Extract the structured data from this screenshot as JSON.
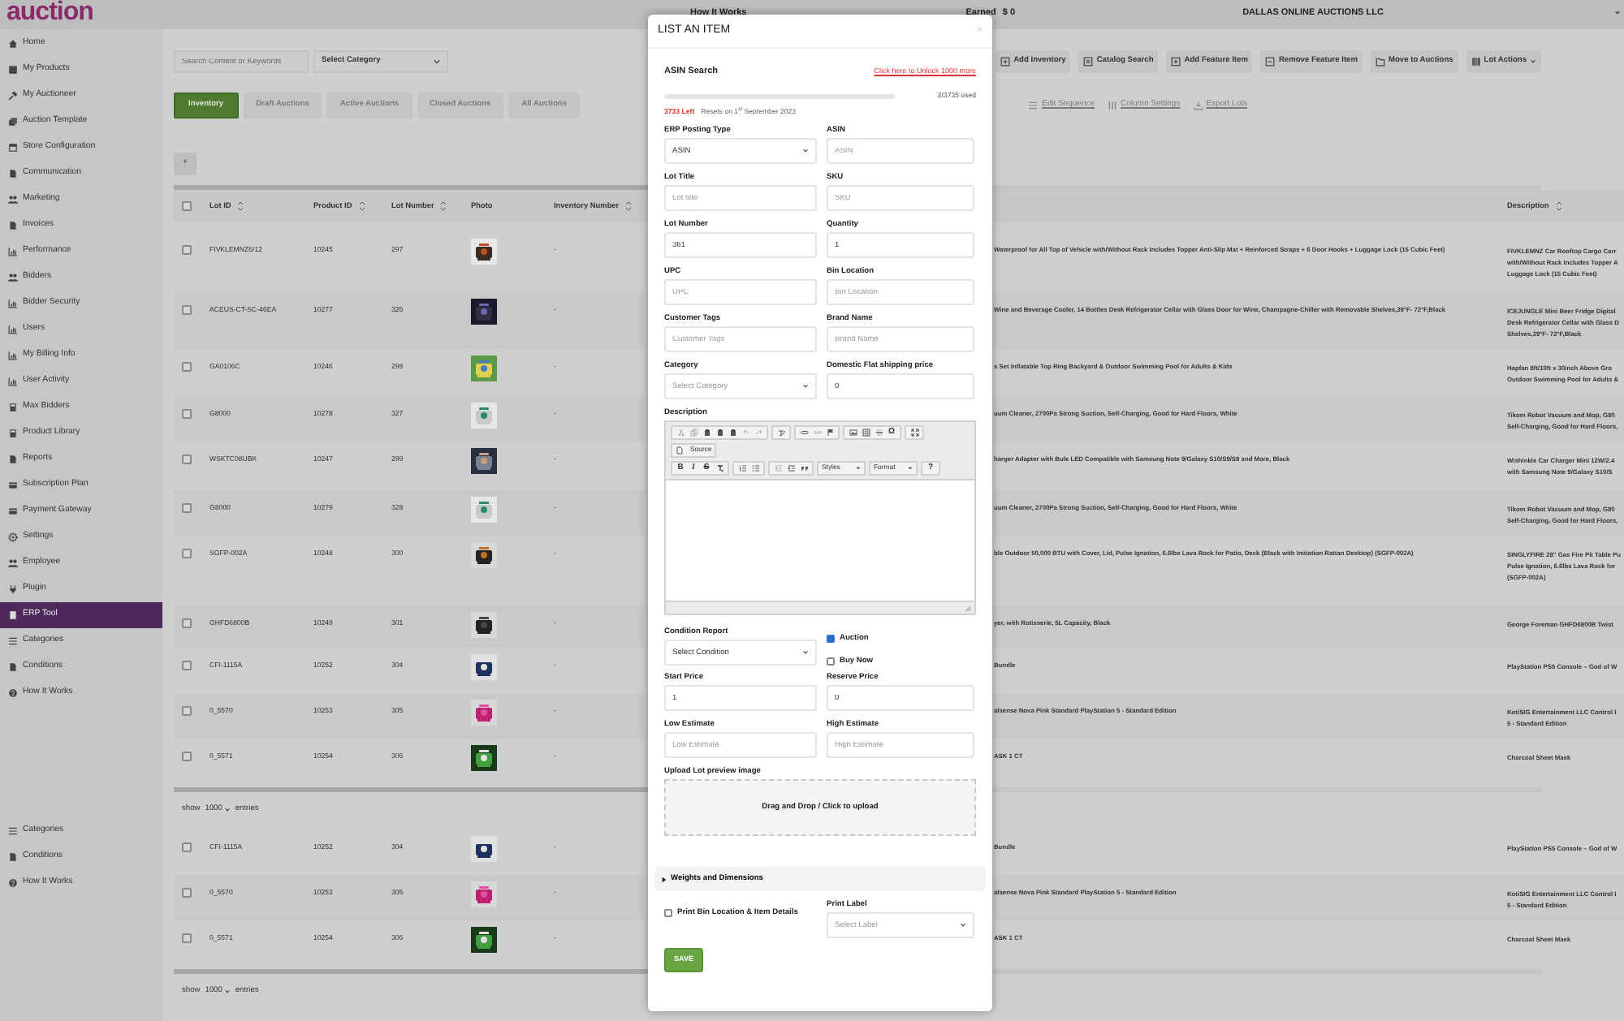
{
  "logo": {
    "text": "auction"
  },
  "header": {
    "links": [
      "How It Works",
      "Earned",
      "$ 0"
    ],
    "company": "DALLAS ONLINE AUCTIONS LLC"
  },
  "sidebar": {
    "items": [
      {
        "label": "Home",
        "selected": false
      },
      {
        "label": "My Products",
        "selected": false
      },
      {
        "label": "My Auctioneer",
        "selected": false
      },
      {
        "label": "Auction Template",
        "selected": false
      },
      {
        "label": "Store Configuration",
        "selected": false
      },
      {
        "label": "Communication",
        "selected": false
      },
      {
        "label": "Marketing",
        "selected": false
      },
      {
        "label": "Invoices",
        "selected": false
      },
      {
        "label": "Performance",
        "selected": false
      },
      {
        "label": "Bidders",
        "selected": false
      },
      {
        "label": "Bidder Security",
        "selected": false
      },
      {
        "label": "Users",
        "selected": false
      },
      {
        "label": "My Billing Info",
        "selected": false
      },
      {
        "label": "User Activity",
        "selected": false
      },
      {
        "label": "Max Bidders",
        "selected": false
      },
      {
        "label": "Product Library",
        "selected": false
      },
      {
        "label": "Reports",
        "selected": false
      },
      {
        "label": "Subscription Plan",
        "selected": false
      },
      {
        "label": "Payment Gateway",
        "selected": false
      },
      {
        "label": "Settings",
        "selected": false
      },
      {
        "label": "Employee",
        "selected": false
      },
      {
        "label": "Plugin",
        "selected": false
      },
      {
        "label": "ERP Tool",
        "selected": true
      },
      {
        "label": "Categories",
        "selected": false
      },
      {
        "label": "Conditions",
        "selected": false
      },
      {
        "label": "How It Works",
        "selected": false
      }
    ],
    "lower_items": [
      {
        "label": "Categories",
        "selected": false
      },
      {
        "label": "Conditions",
        "selected": false
      },
      {
        "label": "How It Works",
        "selected": false
      }
    ]
  },
  "filters": {
    "search": {
      "placeholder": "Search Content or Keywords"
    },
    "category": {
      "value": "Select Category"
    }
  },
  "toolbar": [
    "Add Inventory",
    "Catalog Search",
    "Add Feature Item",
    "Remove Feature Item",
    "Move to Auctions",
    "Lot Actions"
  ],
  "toolbar_links": [
    "Edit Sequence",
    "Column Settings",
    "Export Lots"
  ],
  "tabs": [
    {
      "label": "Inventory",
      "selected": true
    },
    {
      "label": "Draft Auctions",
      "selected": false
    },
    {
      "label": "Active Auctions",
      "selected": false
    },
    {
      "label": "Closed Auctions",
      "selected": false
    },
    {
      "label": "All Auctions",
      "selected": false
    }
  ],
  "add_button": "+",
  "table": {
    "header_checked": false,
    "columns": [
      "Lot ID",
      "Product ID",
      "Lot Number",
      "Photo",
      "Inventory Number",
      "Description"
    ],
    "rows": [
      {
        "checked": false,
        "lot_id": "FIVKLEMNZ6/12",
        "product_id": "10245",
        "lot_number": "297",
        "inventory_number": "-",
        "title": "Waterproof for All Top of Vehicle with/Without Rack Includes Topper Anti-Slip Mat + Reinforced Straps + 6 Door Hooks + Luggage Lock (15 Cubic Feet)",
        "description": "FIVKLEMNZ Car Rooftop Cargo Carr with/Without Rack Includes Topper A Luggage Lock (15 Cubic Feet)"
      },
      {
        "checked": false,
        "lot_id": "ACEUS-CT-SC-46EA",
        "product_id": "10277",
        "lot_number": "326",
        "inventory_number": "-",
        "title": "Wine and Beverage Cooler, 14 Bottles Desk Refrigerator Cellar with Glass Door for Wine, Champagne-Chiller with Removable Shelves,39°F- 72°F,Black",
        "description": "ICEJUNGLE Mini Beer Fridge Digital Desk Refrigerator Cellar with Glass D Shelves,39°F- 72°F,Black"
      },
      {
        "checked": false,
        "lot_id": "GA0106C",
        "product_id": "10246",
        "lot_number": "298",
        "inventory_number": "-",
        "title": "s Set Inflatable Top Ring Backyard & Outdoor Swimming Pool for Adults & Kids",
        "description": "Hapfan 8ft/10ft x 30inch Above Gro Outdoor Swimming Pool for Adults &"
      },
      {
        "checked": false,
        "lot_id": "G8000",
        "product_id": "10278",
        "lot_number": "327",
        "inventory_number": "-",
        "title": "uum Cleaner, 2700Pa Strong Suction, Self-Charging, Good for Hard Floors, White",
        "description": "Tikom Robot Vacuum and Mop, G80 Self-Charging, Good for Hard Floors,"
      },
      {
        "checked": false,
        "lot_id": "WSKTC08UBK",
        "product_id": "10247",
        "lot_number": "299",
        "inventory_number": "-",
        "title": "harger Adapter with Bule LED Compatible with Samsung Note 9/Galaxy S10/S9/S8 and More, Black",
        "description": "Wishinkle Car Charger Mini 12W/2.4 with Samsung Note 9/Galaxy S10/S"
      },
      {
        "checked": false,
        "lot_id": "G8000",
        "product_id": "10279",
        "lot_number": "328",
        "inventory_number": "-",
        "title": "uum Cleaner, 2700Pa Strong Suction, Self-Charging, Good for Hard Floors, White",
        "description": "Tikom Robot Vacuum and Mop, G80 Self-Charging, Good for Hard Floors,"
      },
      {
        "checked": false,
        "lot_id": "SGFP-002A",
        "product_id": "10248",
        "lot_number": "300",
        "inventory_number": "-",
        "title": "ble Outdoor 50,000 BTU with Cover, Lid, Pulse Ignation, 6.6lbs Lava Rock for Patio, Deck (Black with Imitation Rattan Desktop) (SGFP-002A)",
        "description": "SINGLYFIRE 28\" Gas Fire Pit Table Pu Pulse Ignation, 6.6lbs Lava Rock for (SGFP-002A)"
      },
      {
        "checked": false,
        "lot_id": "GHFD6800B",
        "product_id": "10249",
        "lot_number": "301",
        "inventory_number": "-",
        "title": "yer, with Rotisserie, 5L Capacity, Black",
        "description": "George Foreman GHFD6800B Twist"
      },
      {
        "checked": false,
        "lot_id": "CFI-1115A",
        "product_id": "10252",
        "lot_number": "304",
        "inventory_number": "-",
        "title": "Bundle",
        "description": "PlayStation PS5 Console – God of W"
      },
      {
        "checked": false,
        "lot_id": "0_5570",
        "product_id": "10253",
        "lot_number": "305",
        "inventory_number": "-",
        "title": "alsense Nova Pink Standard PlayStation 5 - Standard Edition",
        "description": "KotiSIG Entertainment LLC Control I 5 - Standard Edition"
      },
      {
        "checked": false,
        "lot_id": "0_5571",
        "product_id": "10254",
        "lot_number": "306",
        "inventory_number": "-",
        "title": "ASK 1 CT",
        "description": "Charcoal Sheet Mask"
      }
    ],
    "entries": {
      "before": "show",
      "value": "1000",
      "after": "entries"
    }
  },
  "lower_table": {
    "rows": [
      {
        "checked": false,
        "lot_id": "CFI-1115A",
        "product_id": "10252",
        "lot_number": "304",
        "inventory_number": "-",
        "title": "Bundle",
        "description": "PlayStation PS5 Console – God of W"
      },
      {
        "checked": false,
        "lot_id": "0_5570",
        "product_id": "10253",
        "lot_number": "305",
        "inventory_number": "-",
        "title": "alsense Nova Pink Standard PlayStation 5 - Standard Edition",
        "description": "KotiSIG Entertainment LLC Control I 5 - Standard Edition"
      },
      {
        "checked": false,
        "lot_id": "0_5571",
        "product_id": "10254",
        "lot_number": "306",
        "inventory_number": "-",
        "title": "ASK 1 CT",
        "description": "Charcoal Sheet Mask"
      }
    ],
    "entries": {
      "before": "show",
      "value": "1000",
      "after": "entries"
    }
  },
  "modal": {
    "title": "LIST AN ITEM",
    "close": "×",
    "asin": {
      "heading": "ASIN Search",
      "unlock_link": "Click here to Unlock 1000 more",
      "level": 0.0005,
      "used": "2/3735 used",
      "left": "3733 Left",
      "resets": "Resets on 1$^{st}$ September 2023"
    },
    "fields": [
      {
        "label": "ERP Posting Type",
        "kind": "select",
        "value": "ASIN"
      },
      {
        "label": "ASIN",
        "kind": "input",
        "placeholder": "ASIN"
      },
      {
        "label": "Lot Title",
        "kind": "input",
        "placeholder": "Lot title"
      },
      {
        "label": "SKU",
        "kind": "input",
        "placeholder": "SKU"
      },
      {
        "label": "Lot Number",
        "kind": "input",
        "value": "361"
      },
      {
        "label": "Quantity",
        "kind": "input",
        "value": "1"
      },
      {
        "label": "UPC",
        "kind": "input",
        "placeholder": "UPC"
      },
      {
        "label": "Bin Location",
        "kind": "input",
        "placeholder": "Bin Location"
      },
      {
        "label": "Customer Tags",
        "kind": "input",
        "placeholder": "Customer Tags"
      },
      {
        "label": "Brand Name",
        "kind": "input",
        "placeholder": "Brand Name"
      },
      {
        "label": "Category",
        "kind": "select",
        "placeholder": "Select Category"
      },
      {
        "label": "Domestic Flat shipping price",
        "kind": "input",
        "value": "0"
      }
    ],
    "description": {
      "label": "Description",
      "source": "Source",
      "bold": "B",
      "italic": "I",
      "strike": "S",
      "special": "Ω",
      "styles": "Styles",
      "format": "Format",
      "help": "?"
    },
    "condition": {
      "label": "Condition Report",
      "value": "Select Condition"
    },
    "options": [
      {
        "label": "Auction",
        "checked": true
      },
      {
        "label": "Buy Now",
        "checked": false
      }
    ],
    "price_fields": [
      {
        "label": "Start Price",
        "kind": "input",
        "value": "1"
      },
      {
        "label": "Reserve Price",
        "kind": "input",
        "value": "0"
      },
      {
        "label": "Low Estimate",
        "kind": "input",
        "placeholder": "Low Estimate"
      },
      {
        "label": "High Estimate",
        "kind": "input",
        "placeholder": "High Estimate"
      }
    ],
    "upload": {
      "label": "Upload Lot preview image",
      "text": "Drag and Drop / Click to upload"
    },
    "weights": {
      "label": "Weights and Dimensions",
      "expanded": false
    },
    "print_bin": {
      "label": "Print Bin Location & Item Details",
      "checked": false
    },
    "print_label": {
      "label": "Print Label",
      "placeholder": "Select Label"
    },
    "save": "SAVE"
  }
}
